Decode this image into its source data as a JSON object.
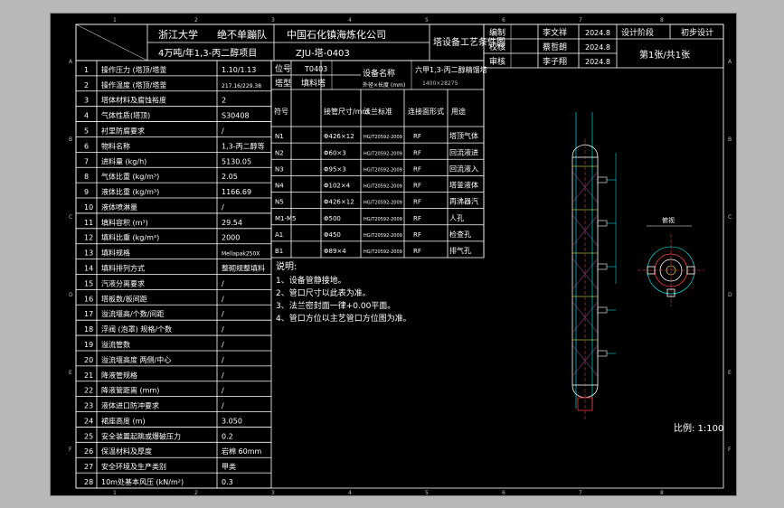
{
  "title_block": {
    "school": "浙江大学",
    "team": "绝不单蹦队",
    "company": "中国石化镇海炼化公司",
    "project": "4万吨/年1,3-丙二醇项目",
    "drawing_no": "ZJU-塔-0403",
    "drawing_title": "塔设备工艺条件图",
    "equipment": "六甲1,3-丙二醇精馏塔",
    "size": "1400×28275"
  },
  "approval": {
    "rows": [
      {
        "role": "编制",
        "name": "李文祥",
        "date": "2024.8",
        "extra": "设计阶段",
        "extra2": "初步设计"
      },
      {
        "role": "校核",
        "name": "蔡哲朗",
        "date": "2024.8"
      },
      {
        "role": "审核",
        "name": "李子翔",
        "date": "2024.8"
      }
    ],
    "sheet": "第1张/共1张"
  },
  "parameters": [
    {
      "no": "1",
      "name": "操作压力 (塔顶/塔釜",
      "value": "1.10/1.13"
    },
    {
      "no": "2",
      "name": "操作温度 (塔顶/塔釜",
      "value": "217.16/229.38"
    },
    {
      "no": "3",
      "name": "塔体材料及腐蚀裕度",
      "value": "2"
    },
    {
      "no": "4",
      "name": "气体性质(塔顶)",
      "value": "S30408"
    },
    {
      "no": "5",
      "name": "衬里防腐要求",
      "value": "/"
    },
    {
      "no": "6",
      "name": "物料名称",
      "value": "1,3-丙二醇等"
    },
    {
      "no": "7",
      "name": "进料量 (kg/h)",
      "value": "5130.05"
    },
    {
      "no": "8",
      "name": "气体比重 (kg/m³)",
      "value": "2.05"
    },
    {
      "no": "9",
      "name": "液体比重 (kg/m³)",
      "value": "1166.69"
    },
    {
      "no": "10",
      "name": "液体喷淋量",
      "value": "/"
    },
    {
      "no": "11",
      "name": "填料容积 (m³)",
      "value": "29.54"
    },
    {
      "no": "12",
      "name": "填料比重 (kg/m³)",
      "value": "2000"
    },
    {
      "no": "13",
      "name": "填料规格",
      "value": "Mellapak250X"
    },
    {
      "no": "14",
      "name": "填料排列方式",
      "value": "整砌规整填料"
    },
    {
      "no": "15",
      "name": "汽液分离要求",
      "value": "/"
    },
    {
      "no": "16",
      "name": "塔板数/板间距",
      "value": "/"
    },
    {
      "no": "17",
      "name": "溢流堰高/个数/间距",
      "value": "/"
    },
    {
      "no": "18",
      "name": "浮阀 (泡罩) 规格/个数",
      "value": "/"
    },
    {
      "no": "19",
      "name": "溢流管数",
      "value": "/"
    },
    {
      "no": "20",
      "name": "溢流堰高度 两侧/中心",
      "value": "/"
    },
    {
      "no": "21",
      "name": "降液管规格",
      "value": "/"
    },
    {
      "no": "22",
      "name": "降液管距离 (mm)",
      "value": "/"
    },
    {
      "no": "23",
      "name": "液体进口防冲要求",
      "value": "/"
    },
    {
      "no": "24",
      "name": "裙座高度 (m)",
      "value": "3.050"
    },
    {
      "no": "25",
      "name": "安全装置起跳或爆破压力",
      "value": "0.2"
    },
    {
      "no": "26",
      "name": "保温材料及厚度",
      "value": "岩棉 60mm"
    },
    {
      "no": "27",
      "name": "安全环境及生产类别",
      "value": "甲类"
    },
    {
      "no": "28",
      "name": "10m处基本风压 (kN/m²)",
      "value": "0.3"
    }
  ],
  "nozzle_table": {
    "top": {
      "label1": "位号",
      "val1": "T0403",
      "label2": "塔型",
      "val2": "填料塔",
      "label3": "设备名称",
      "label4": "外径×长度 (mm)"
    },
    "headers": [
      "符号",
      "接管尺寸/mm",
      "法兰标准",
      "连接面形式",
      "用途"
    ],
    "rows": [
      {
        "sym": "N1",
        "size": "Φ426×12",
        "std": "HG/T20592-2009",
        "face": "RF",
        "use": "塔顶气体"
      },
      {
        "sym": "N2",
        "size": "Φ60×3",
        "std": "HG/T20592-2009",
        "face": "RF",
        "use": "回流液进"
      },
      {
        "sym": "N3",
        "size": "Φ95×3",
        "std": "HG/T20592-2009",
        "face": "RF",
        "use": "回流液入"
      },
      {
        "sym": "N4",
        "size": "Φ102×4",
        "std": "HG/T20592-2009",
        "face": "RF",
        "use": "塔釜液体"
      },
      {
        "sym": "N5",
        "size": "Φ426×12",
        "std": "HG/T20592-2009",
        "face": "RF",
        "use": "再沸器汽"
      },
      {
        "sym": "M1-M5",
        "size": "Φ500",
        "std": "HG/T20592-2009",
        "face": "RF",
        "use": "人孔"
      },
      {
        "sym": "A1",
        "size": "Φ450",
        "std": "HG/T20592-2009",
        "face": "RF",
        "use": "检查孔"
      },
      {
        "sym": "B1",
        "size": "Φ89×4",
        "std": "HG/T20592-2009",
        "face": "RF",
        "use": "排气孔"
      }
    ]
  },
  "notes": {
    "title": "说明:",
    "lines": [
      "1、设备管静接地。",
      "2、管口尺寸以此表为准。",
      "3、法兰密封面一律+0.00平面。",
      "4、管口方位以主艺管口方位图为准。"
    ]
  },
  "scale": "比例: 1:100",
  "view_label": "俯视",
  "grid": {
    "cols": [
      "1",
      "2",
      "3",
      "4",
      "5",
      "6",
      "7",
      "8"
    ],
    "rows": [
      "A",
      "B",
      "C",
      "D",
      "E",
      "F"
    ]
  }
}
